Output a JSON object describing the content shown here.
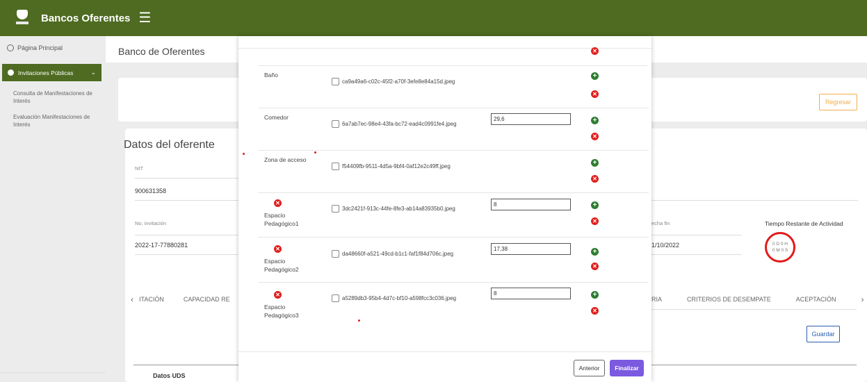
{
  "header": {
    "app_title": "Bancos Oferentes",
    "menu_icon": "☰"
  },
  "sidebar": {
    "home_label": "Página Principal",
    "section_label": "Invitaciones Públicas",
    "links": [
      "Consulta de Manifestaciones de Interés",
      "Evaluación Manifestaciones de Interés"
    ]
  },
  "main": {
    "breadcrumb_title": "Banco de Oferentes",
    "regresar_label": "Regresar",
    "datos_title": "Datos del oferente",
    "nit_label": "NIT",
    "nit_value": "900631358",
    "invitacion_label": "No. invitación",
    "invitacion_value": "2022-17-77880281",
    "fecha_fin_label": "echa fin",
    "fecha_fin_value": "1/10/2022",
    "tiempo_label": "Tiempo Restante de Actividad",
    "timer_line1": "0 D 0 H",
    "timer_line2": "0 M 0 S",
    "tabs_left": [
      "‹",
      "ITACIÓN",
      "CAPACIDAD RE"
    ],
    "tabs_right": [
      "RIA",
      "CRITERIOS DE DESEMPATE",
      "ACEPTACIÓN",
      "›"
    ],
    "guardar_label": "Guardar",
    "datos_uds_label": "Datos UDS"
  },
  "modal": {
    "rows": [
      {
        "label": "Baño",
        "file": "ca9a49a6-c02c-45f2-a70f-3efe8e84a15d.jpeg",
        "value": ""
      },
      {
        "label": "Comedor",
        "file": "6a7ab7ec-98e4-43fa-bc72-ead4c0991fe4.jpeg",
        "value": "29,6"
      },
      {
        "label": "Zona de acceso",
        "file": "f54409fb-9511-4d5a-9bf4-0af12e2c49ff.jpeg",
        "value": ""
      },
      {
        "label": "Espacio Pedagógico1",
        "file": "3dc2421f-913c-44fe-8fe3-ab14a83935b0.jpeg",
        "value": "8"
      },
      {
        "label": "Espacio Pedagógico2",
        "file": "da48660f-a521-49cd-b1c1-faf1f84d706c.jpeg",
        "value": "17,38"
      },
      {
        "label": "Espacio Pedagógico3",
        "file": "a5289db3-95b4-4d7c-bf10-a598fcc3c036.jpeg",
        "value": "8"
      }
    ],
    "anterior_label": "Anterior",
    "finalizar_label": "Finalizar"
  },
  "colors": {
    "header_green": "#4e6b21",
    "delete_red": "#e0201f",
    "add_green": "#2e7d32",
    "finalizar_purple": "#7b5ae0"
  }
}
